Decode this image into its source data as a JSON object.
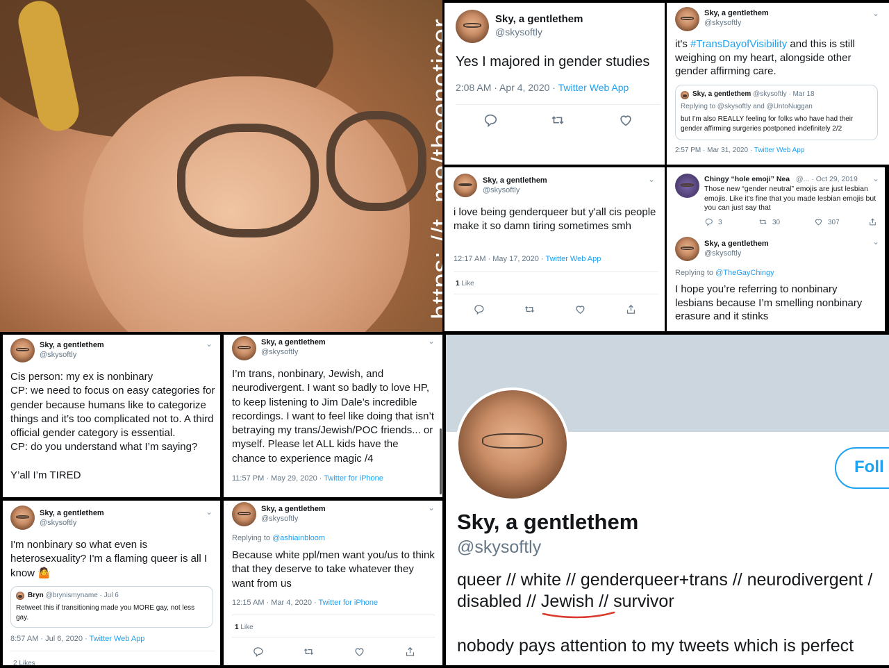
{
  "photo": {
    "watermark": "https: //t. me/theenoticer"
  },
  "p2": {
    "name": "Sky, a gentlethem",
    "handle": "@skysoftly",
    "text": "Yes I majored in gender studies",
    "time": "2:08 AM · Apr 4, 2020 · ",
    "source": "Twitter Web App"
  },
  "p3": {
    "name": "Sky, a gentlethem",
    "handle": "@skysoftly",
    "text_pre": "it's ",
    "hashtag": "#TransDayofVisibility",
    "text_post": " and this is still weighing on my heart, alongside other gender affirming care.",
    "quote": {
      "name": "Sky, a gentlethem",
      "meta": "@skysoftly · Mar 18",
      "replying": "Replying to @skysoftly and @UntoNuggan",
      "text": "but I'm also REALLY feeling for folks who have had their gender affirming surgeries postponed indefinitely 2/2"
    },
    "time": "2:57 PM · Mar 31, 2020 · ",
    "source": "Twitter Web App"
  },
  "p4": {
    "name": "Sky, a gentlethem",
    "handle": "@skysoftly",
    "text": "i love being genderqueer but y'all cis people make it so damn tiring sometimes smh",
    "time": "12:17 AM · May 17, 2020 · ",
    "source": "Twitter Web App",
    "likes_count": "1",
    "likes_label": " Like"
  },
  "p5": {
    "top_name": "Chingy “hole emoji” Nea",
    "top_meta": "@... · Oct 29, 2019",
    "top_text": "Those new “gender neutral” emojis are just lesbian emojis. Like it's fine that you made lesbian emojis but you can just say that",
    "replies": "3",
    "retweets": "30",
    "likes": "307",
    "name": "Sky, a gentlethem",
    "handle": "@skysoftly",
    "replying_pre": "Replying to ",
    "replying_to": "@TheGayChingy",
    "text": "I hope you’re referring to nonbinary lesbians because I’m smelling nonbinary erasure and it stinks"
  },
  "p6": {
    "name": "Sky, a gentlethem",
    "handle": "@skysoftly",
    "lines": [
      "Cis person: my ex is nonbinary",
      "CP: we need to focus on easy categories for gender because humans like to categorize things and it’s too complicated not to. A third official gender category is essential.",
      "CP: do you understand what I’m saying?",
      "",
      "Y’all I’m TIRED"
    ]
  },
  "p7": {
    "name": "Sky, a gentlethem",
    "handle": "@skysoftly",
    "text": "I’m trans, nonbinary, Jewish, and neurodivergent. I want so badly to love HP, to keep listening to Jim Dale’s incredible recordings. I want to feel like doing that isn’t betraying my trans/Jewish/POC friends... or myself. Please let ALL kids have the chance to experience magic /4",
    "time": "11:57 PM · May 29, 2020 · ",
    "source": "Twitter for iPhone"
  },
  "p8": {
    "name": "Sky, a gentlethem",
    "handle": "@skysoftly",
    "text": "I'm nonbinary so what even is heterosexuality? I'm a flaming queer is all I know 🤷",
    "quote": {
      "name": "Bryn",
      "meta": "@brynismyname · Jul 6",
      "text": "Retweet this if transitioning made you MORE gay, not less gay."
    },
    "time": "8:57 AM · Jul 6, 2020 · ",
    "source": "Twitter Web App",
    "likes_partial": "2 Likes"
  },
  "p9": {
    "name": "Sky, a gentlethem",
    "handle": "@skysoftly",
    "replying_pre": "Replying to ",
    "replying_to": "@ashiainbloom",
    "text": "Because white ppl/men want you/us to think that they deserve to take whatever they want from us",
    "time": "12:15 AM · Mar 4, 2020 · ",
    "source": "Twitter for iPhone",
    "likes_count": "1",
    "likes_label": " Like"
  },
  "profile": {
    "follow": "Foll",
    "name": "Sky, a gentlethem",
    "handle": "@skysoftly",
    "bio_line1": "queer // white // genderqueer+trans // neurodivergent /",
    "bio_line2_pre": "disabled // ",
    "bio_jewish": "Jewish",
    "bio_line2_post": " // survivor",
    "bio_line3": "nobody pays attention to my tweets which is perfect"
  },
  "colors": {
    "link": "#1da1f2",
    "text": "#14171a",
    "muted": "#657786",
    "banner": "#cbd6df",
    "underline": "#d93a2b"
  },
  "icons": [
    "reply-icon",
    "retweet-icon",
    "like-icon",
    "share-icon",
    "chevron-down-icon"
  ]
}
